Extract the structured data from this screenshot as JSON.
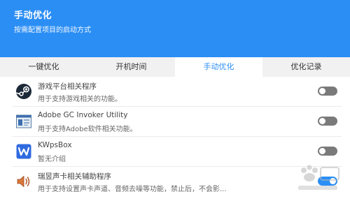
{
  "header": {
    "title": "手动优化",
    "subtitle": "按需配置项目的启动方式"
  },
  "tabs": [
    {
      "label": "一键优化",
      "active": false
    },
    {
      "label": "开机时间",
      "active": false
    },
    {
      "label": "手动优化",
      "active": true
    },
    {
      "label": "优化记录",
      "active": false
    }
  ],
  "items": [
    {
      "icon": "steam-icon",
      "name": "游戏平台相关程序",
      "desc": "用于支持游戏相关的功能。",
      "enabled": false
    },
    {
      "icon": "adobe-gc-icon",
      "name": "Adobe GC Invoker Utility",
      "desc": "用于支持Adobe软件相关功能。",
      "enabled": false
    },
    {
      "icon": "wps-icon",
      "name": "KWpsBox",
      "desc": "暂无介绍",
      "enabled": false
    },
    {
      "icon": "speaker-icon",
      "name": "瑞昱声卡相关辅助程序",
      "desc": "用于支持设置声卡声道、音频去噪等功能，禁止后，不会影...",
      "enabled": true
    }
  ],
  "colors": {
    "accent": "#2b8ef5",
    "toggle_off": "#7a7a7a"
  }
}
